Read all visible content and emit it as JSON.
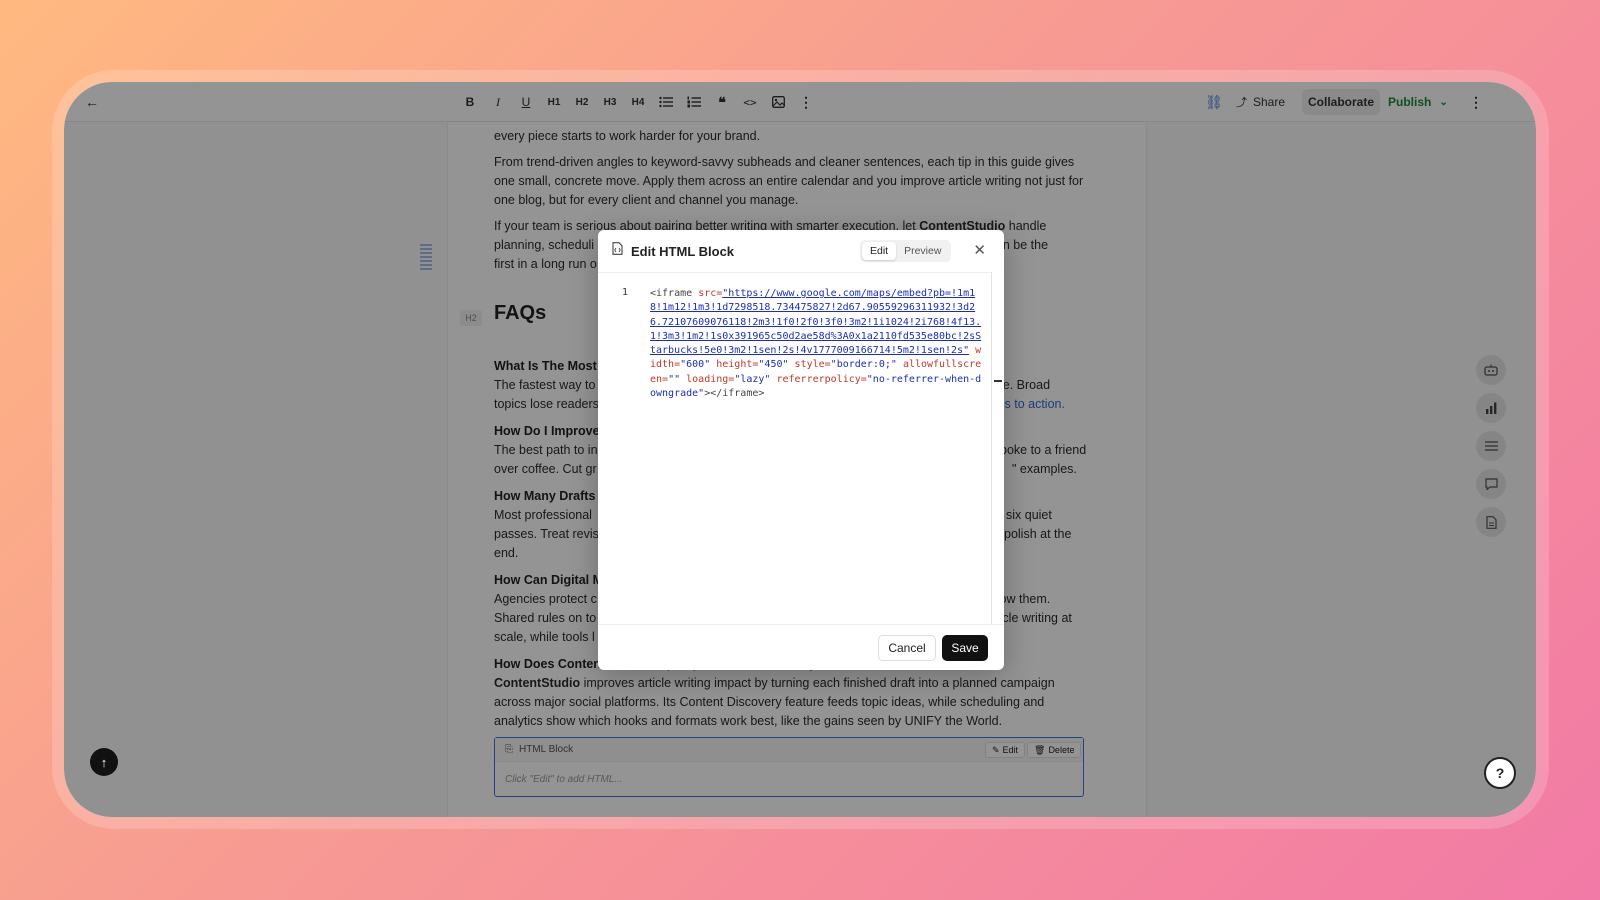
{
  "toolbar": {
    "bold": "B",
    "italic": "I",
    "underline": "U",
    "h1": "H1",
    "h2": "H2",
    "h3": "H3",
    "h4": "H4",
    "share": "Share",
    "collaborate": "Collaborate",
    "publish": "Publish"
  },
  "doc": {
    "p0": "every piece starts to work harder for your brand.",
    "p1": "From trend-driven angles to keyword-savvy subheads and cleaner sentences, each tip in this guide gives one small, concrete move. Apply them across an entire calendar and you improve article writing not just for one blog, but for every client and channel you manage.",
    "p2a": "If your team is serious about pairing better writing with smarter execution, let",
    "p2b": "ContentStudio",
    "p2c": "handle",
    "p2d": "planning, scheduli",
    "p2e": "sh can be the",
    "p2f": "first in a long run o",
    "h2badge": "H2",
    "faqs": "FAQs",
    "q1": "What Is The Most",
    "a1a": "The fastest way to",
    "a1b": "le. Broad",
    "a1c": "topics lose readers",
    "a1d": "alls to action",
    "q2": "How Do I Improve",
    "a2a": "The best path to in",
    "a2b": "poke to a friend",
    "a2c": "over coffee. Cut gr",
    "a2d": "\" examples.",
    "q3": "How Many Drafts",
    "a3a": "Most professional",
    "a3b": "six quiet",
    "a3c": "passes. Treat revis",
    "a3d": "polish at the",
    "a3e": "end.",
    "q4": "How Can Digital M",
    "q4b": "?",
    "a4a": "Agencies protect c",
    "a4b": "llow them.",
    "a4c": "Shared rules on to",
    "a4d": "rticle writing at",
    "a4e": "scale, while tools l",
    "q5": "How Does ContentStudio Help Improve Article Writing And Distribution?",
    "a5a": "ContentStudio",
    "a5b": "improves article writing impact by turning each finished draft into a planned campaign across major social platforms. Its Content Discovery feature feeds topic ideas, while scheduling and analytics show which hooks and formats work best, like the gains seen by UNIFY the World.",
    "html_block_label": "HTML Block",
    "html_block_edit": "Edit",
    "html_block_delete": "Delete",
    "html_block_placeholder": "Click \"Edit\" to add HTML..."
  },
  "modal": {
    "title": "Edit HTML Block",
    "tab_edit": "Edit",
    "tab_preview": "Preview",
    "line_number": "1",
    "code_tag_open": "<iframe",
    "code_src_attr": "src=",
    "code_src_value": "\"https://www.google.com/maps/embed?pb=!1m18!1m12!1m3!1d7298518.734475827!2d67.90559296311932!3d26.72107609076118!2m3!1f0!2f0!3f0!3m2!1i1024!2i768!4f13.1!3m3!1m2!1s0x391965c50d2ae58d%3A0x1a2110fd535e80bc!2sStarbucks!5e0!3m2!1sen!2s!4v1777009166714!5m2!1sen!2s\"",
    "code_width_attr": "width=",
    "code_width_value": "\"600\"",
    "code_height_attr": "height=",
    "code_height_value": "\"450\"",
    "code_style_attr": "style=",
    "code_style_value": "\"border:0;\"",
    "code_allow_attr": "allowfullscreen=",
    "code_allow_value": "\"\"",
    "code_loading_attr": "loading=",
    "code_loading_value": "\"lazy\"",
    "code_ref_attr": "referrerpolicy=",
    "code_ref_value": "\"no-referrer-when-downgrade\"",
    "code_tag_close": "></iframe>",
    "cancel": "Cancel",
    "save": "Save"
  },
  "help_icon": "?",
  "scroll_top_icon": "↑"
}
